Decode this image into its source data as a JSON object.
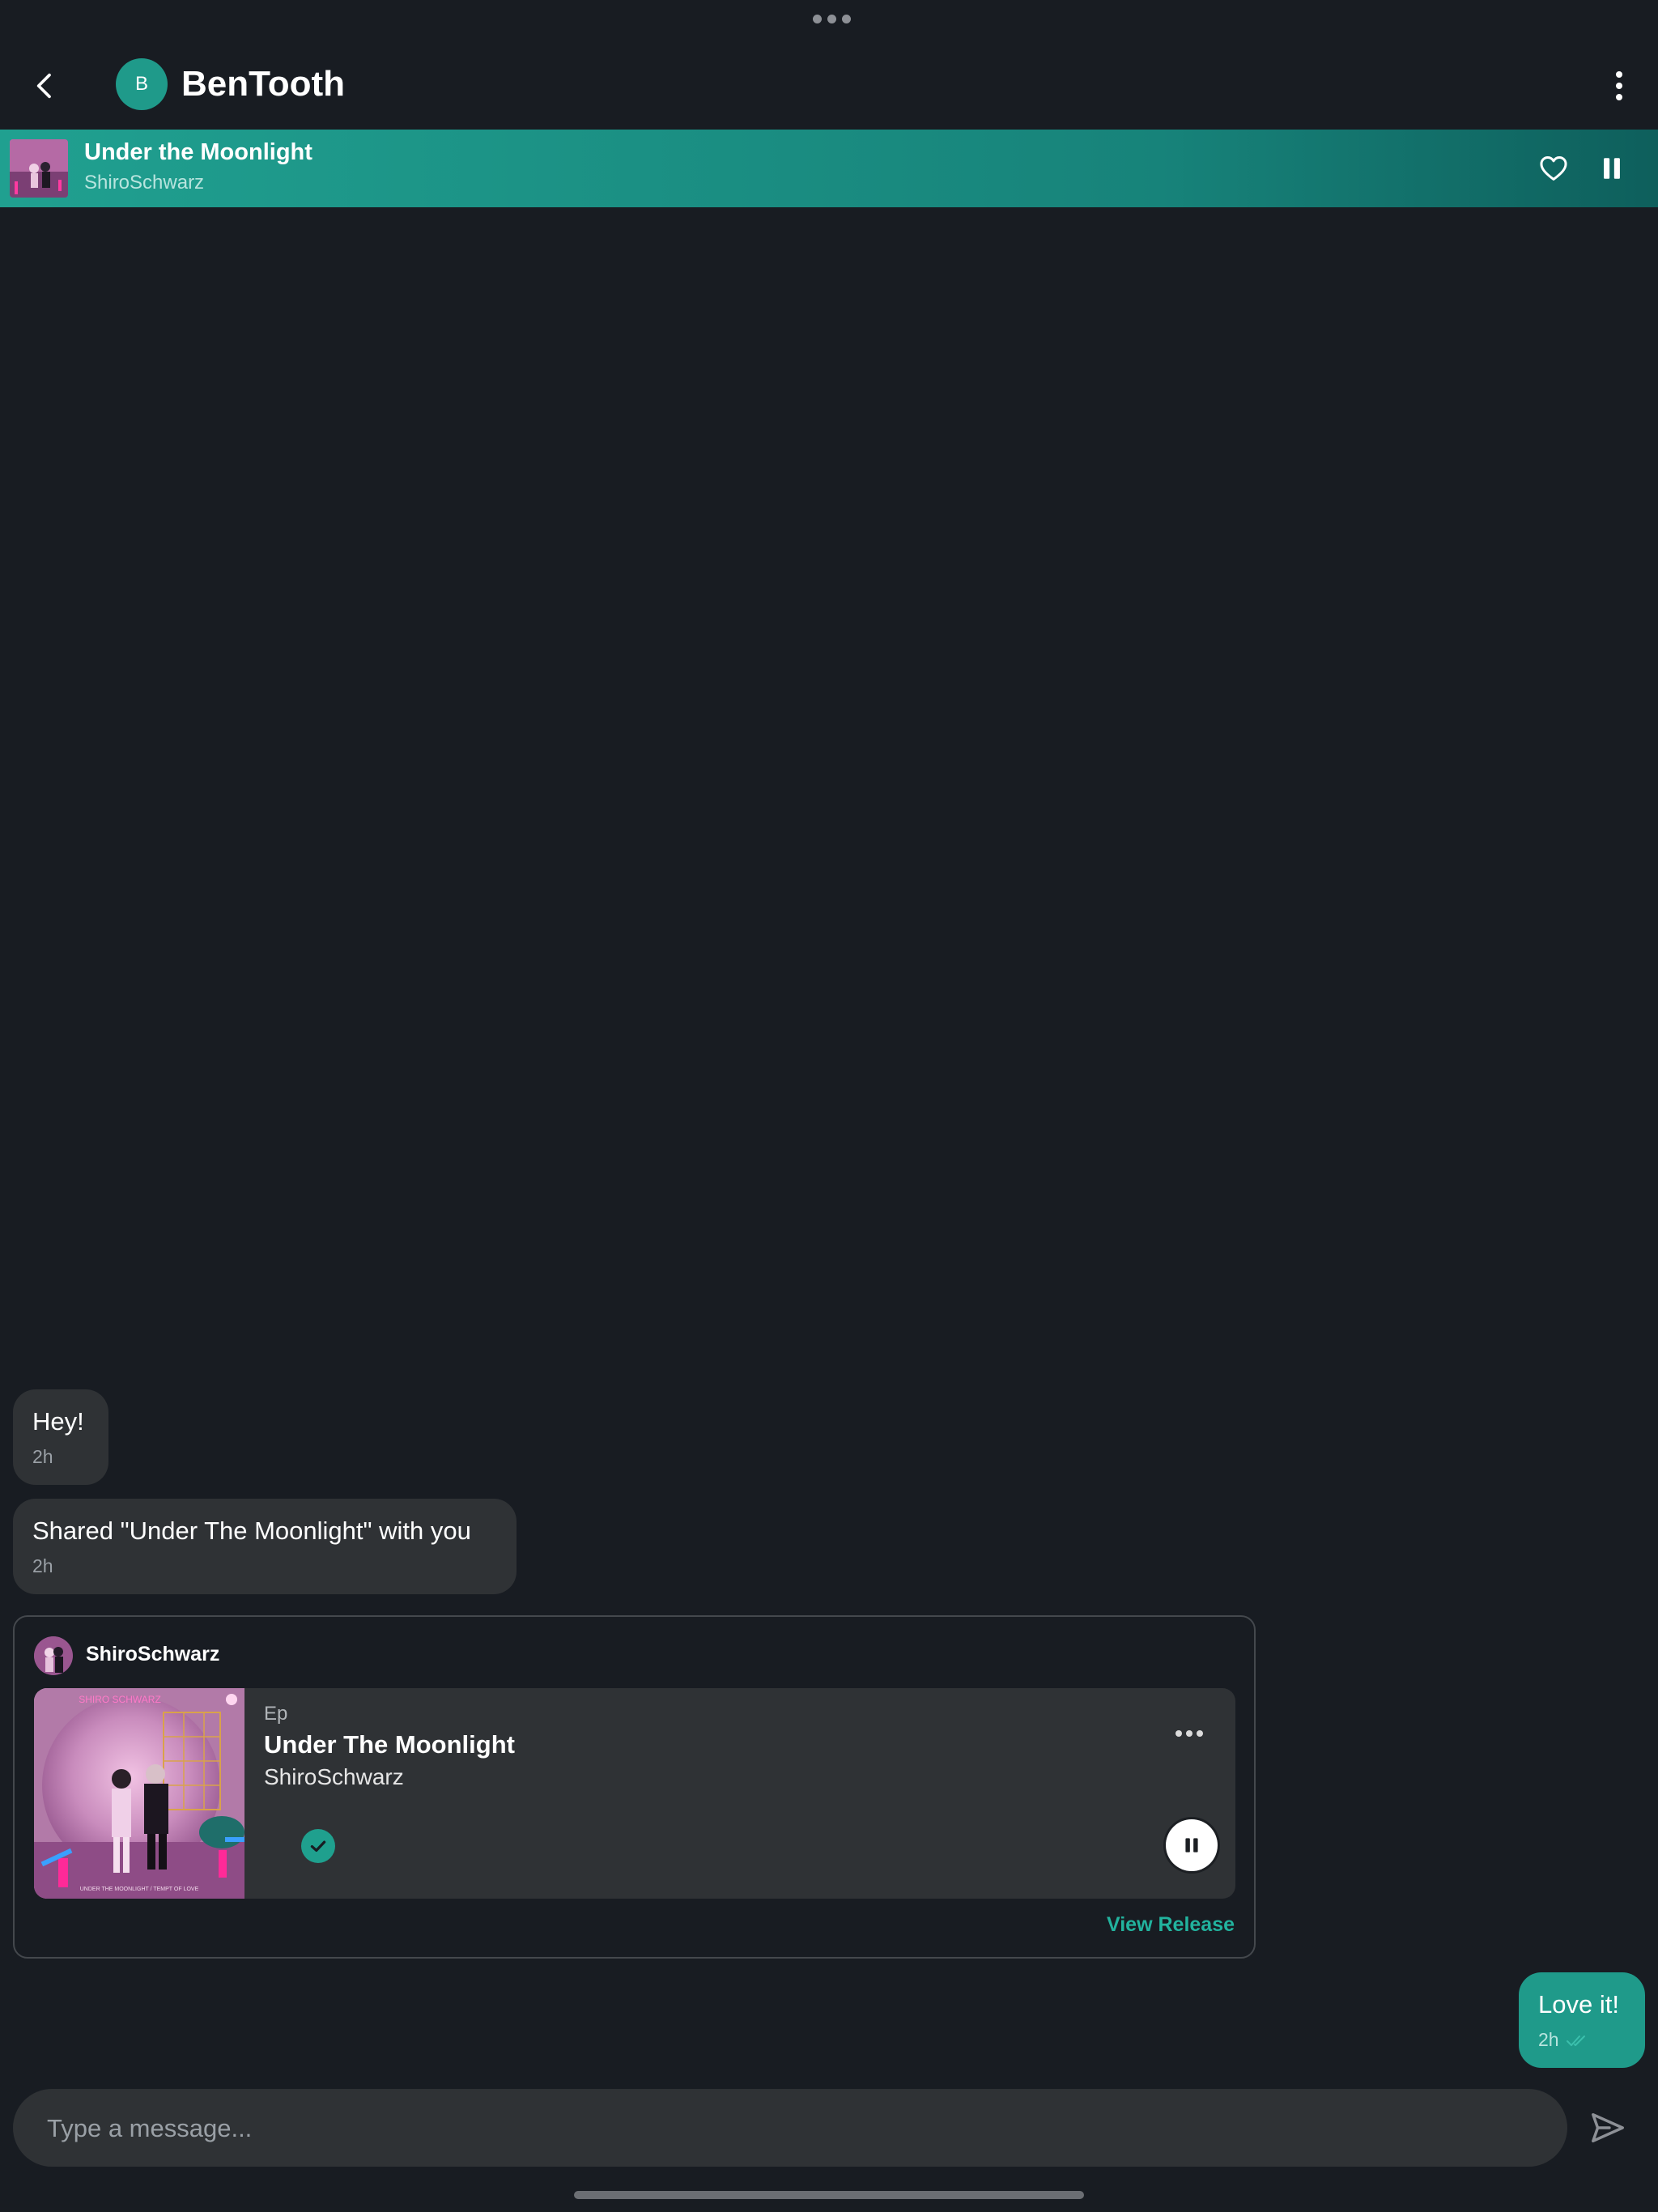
{
  "header": {
    "avatar_initial": "B",
    "title": "BenTooth"
  },
  "now_playing": {
    "title": "Under the Moonlight",
    "artist": "ShiroSchwarz"
  },
  "messages": [
    {
      "text": "Hey!",
      "time": "2h",
      "from": "other"
    },
    {
      "text": "Shared \"Under The Moonlight\" with you",
      "time": "2h",
      "from": "other"
    },
    {
      "text": "Love it!",
      "time": "2h",
      "from": "me"
    }
  ],
  "shared_release": {
    "sharer": "ShiroSchwarz",
    "type": "Ep",
    "title": "Under The Moonlight",
    "artist": "ShiroSchwarz",
    "view_label": "View Release",
    "art_text_top": "SHIRO SCHWARZ",
    "art_text_bottom": "UNDER THE MOONLIGHT / TEMPT OF LOVE"
  },
  "composer": {
    "placeholder": "Type a message..."
  },
  "colors": {
    "background": "#181c22",
    "accent": "#1f9a8a",
    "bubble": "#2f3235",
    "link": "#22b39e"
  }
}
